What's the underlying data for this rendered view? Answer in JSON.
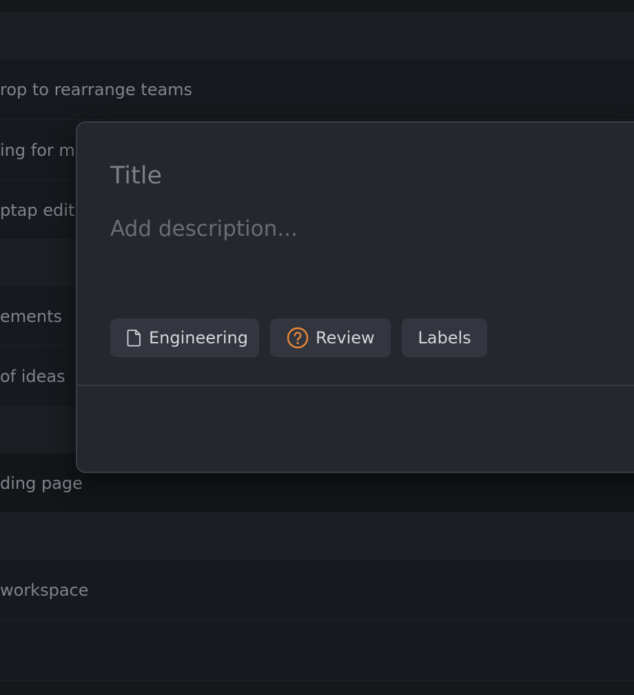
{
  "background_list": {
    "rows": [
      {
        "kind": "top",
        "text": ""
      },
      {
        "kind": "group",
        "text": ""
      },
      {
        "kind": "item",
        "text": "rop to rearrange teams"
      },
      {
        "kind": "item",
        "text": "ing for mo"
      },
      {
        "kind": "item",
        "text": "ptap edit"
      },
      {
        "kind": "group",
        "text": ""
      },
      {
        "kind": "item",
        "text": "ements"
      },
      {
        "kind": "item",
        "text": " of ideas"
      },
      {
        "kind": "group",
        "text": ""
      },
      {
        "kind": "item",
        "text": "ding page"
      },
      {
        "kind": "group",
        "text": ""
      },
      {
        "kind": "item",
        "text": "workspace"
      },
      {
        "kind": "item",
        "text": ""
      }
    ]
  },
  "modal": {
    "title_placeholder": "Title",
    "description_placeholder": "Add description...",
    "chips": {
      "team": {
        "label": "Engineering",
        "icon": "document-icon"
      },
      "status": {
        "label": "Review",
        "icon": "question-circle-icon",
        "color": "#e8893a"
      },
      "labels": {
        "label": "Labels"
      }
    }
  }
}
